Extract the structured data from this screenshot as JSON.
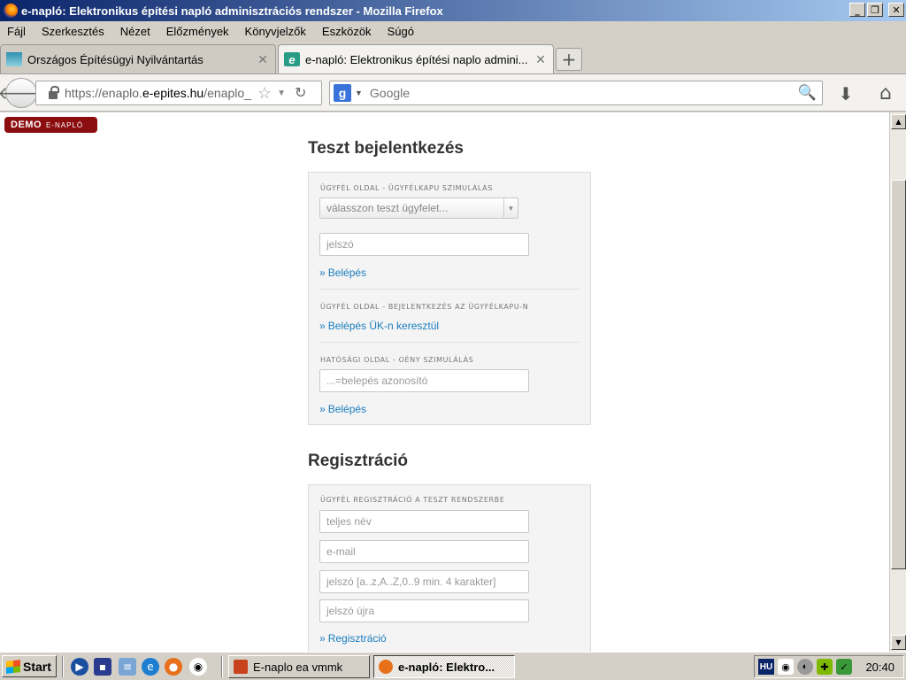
{
  "window": {
    "title": "e-napló: Elektronikus építési napló adminisztrációs rendszer - Mozilla Firefox",
    "controls": {
      "minimize": "_",
      "maximize": "❐",
      "close": "✕"
    }
  },
  "menubar": {
    "items": [
      "Fájl",
      "Szerkesztés",
      "Nézet",
      "Előzmények",
      "Könyvjelzők",
      "Eszközök",
      "Súgó"
    ]
  },
  "tabs": [
    {
      "label": "Országos Építésügyi Nyilvántartás",
      "active": false
    },
    {
      "label": "e-napló: Elektronikus építési naplo admini...",
      "active": true
    }
  ],
  "navbar": {
    "url_prefix": "https://enaplo.",
    "url_domain": "e-epites.hu",
    "url_suffix": "/enaplo_",
    "search_placeholder": "Google"
  },
  "badge": {
    "demo": "DEMO",
    "sub": "E-NAPLÓ"
  },
  "login": {
    "title": "Teszt bejelentkezés",
    "client_sim_label": "Ügyfél oldal - ügyfélkapu szimulálás",
    "client_select": "válasszon teszt ügyfelet...",
    "password_placeholder": "jelszó",
    "login_link": "Belépés",
    "client_real_label": "Ügyfél oldal - bejelentkezés az ügyfélkapu-n",
    "uk_link": "Belépés ÜK-n keresztül",
    "authority_label": "Hatósági oldal - OÉNY szimulálás",
    "authority_placeholder": "...=belepés azonosító",
    "authority_link": "Belépés"
  },
  "registration": {
    "title": "Regisztráció",
    "label": "Ügyfél regisztráció a teszt rendszerbe",
    "fullname_placeholder": "teljes név",
    "email_placeholder": "e-mail",
    "password_placeholder": "jelszó [a..z,A..Z,0..9 min. 4 karakter]",
    "password_again_placeholder": "jelszó újra",
    "register_link": "Regisztráció"
  },
  "taskbar": {
    "start": "Start",
    "tasks": [
      {
        "label": "E-naplo ea vmmk",
        "active": false
      },
      {
        "label": "e-napló: Elektro...",
        "active": true
      }
    ],
    "lang": "HU",
    "clock": "20:40"
  }
}
